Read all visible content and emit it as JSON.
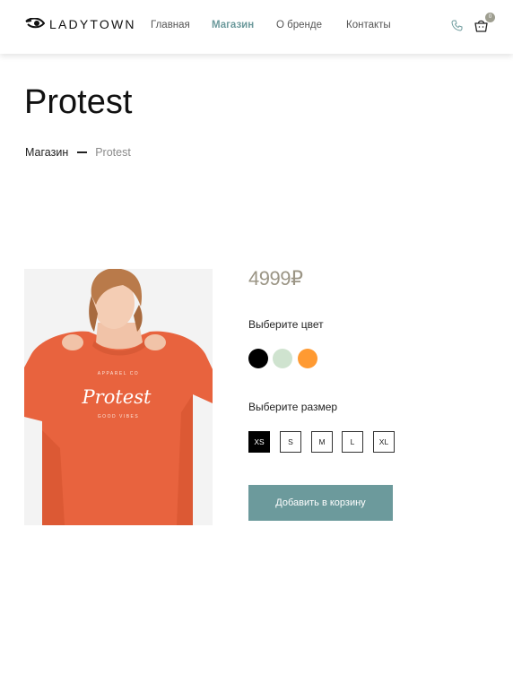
{
  "header": {
    "logo_text": "LADYTOWN",
    "nav": [
      {
        "label": "Главная",
        "active": false
      },
      {
        "label": "Магазин",
        "active": true
      },
      {
        "label": "О бренде",
        "active": false
      },
      {
        "label": "Контакты",
        "active": false
      }
    ],
    "cart_count": "0",
    "icons": [
      "logo-eye-icon",
      "phone-icon",
      "cart-icon"
    ]
  },
  "page": {
    "title": "Protest",
    "breadcrumb": {
      "parent": "Магазин",
      "current": "Protest"
    }
  },
  "product": {
    "price": "4999₽",
    "image": {
      "print_top": "APPAREL CO",
      "print_main": "Protest",
      "print_bottom": "GOOD VIBES"
    },
    "color_label": "Выберите цвет",
    "colors": [
      "#000000",
      "#cfe3cf",
      "#ff9a32"
    ],
    "size_label": "Выберите размер",
    "sizes": [
      "XS",
      "S",
      "M",
      "L",
      "XL"
    ],
    "selected_size": "XS",
    "add_to_cart_label": "Добавить в корзину"
  },
  "theme": {
    "accent": "#6c9a9c",
    "price_color": "#9b9585"
  }
}
